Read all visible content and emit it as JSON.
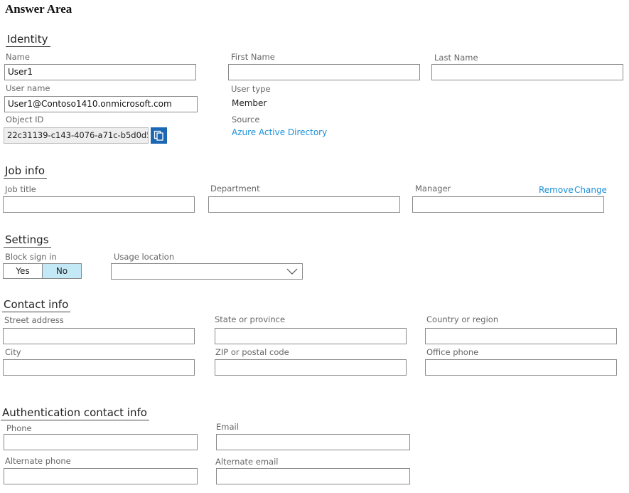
{
  "answer_area": "Answer Area",
  "identity": {
    "heading": "Identity",
    "name_label": "Name",
    "name_value": "User1",
    "first_name_label": "First Name",
    "first_name_value": "",
    "last_name_label": "Last Name",
    "last_name_value": "",
    "user_name_label": "User name",
    "user_name_value": "User1@Contoso1410.onmicrosoft.com",
    "user_type_label": "User type",
    "user_type_value": "Member",
    "object_id_label": "Object ID",
    "object_id_value": "22c31139-c143-4076-a71c-b5d0d5...",
    "source_label": "Source",
    "source_value": "Azure Active Directory"
  },
  "job_info": {
    "heading": "Job info",
    "job_title_label": "Job title",
    "department_label": "Department",
    "manager_label": "Manager",
    "remove_link": "Remove",
    "change_link": "Change"
  },
  "settings": {
    "heading": "Settings",
    "block_sign_in_label": "Block sign in",
    "yes_label": "Yes",
    "no_label": "No",
    "selected": "No",
    "usage_location_label": "Usage location",
    "usage_location_value": ""
  },
  "contact_info": {
    "heading": "Contact info",
    "street_label": "Street address",
    "state_label": "State or province",
    "country_label": "Country or region",
    "city_label": "City",
    "zip_label": "ZIP or postal code",
    "office_phone_label": "Office phone"
  },
  "auth_contact": {
    "heading": "Authentication contact info",
    "phone_label": "Phone",
    "email_label": "Email",
    "alt_phone_label": "Alternate phone",
    "alt_email_label": "Alternate email"
  },
  "icons": {
    "copy": "copy-icon",
    "dropdown": "chevron-down-icon"
  },
  "colors": {
    "link": "#1a8fd8",
    "copy_button": "#1c67b4",
    "toggle_selected": "#c3e9f7"
  }
}
